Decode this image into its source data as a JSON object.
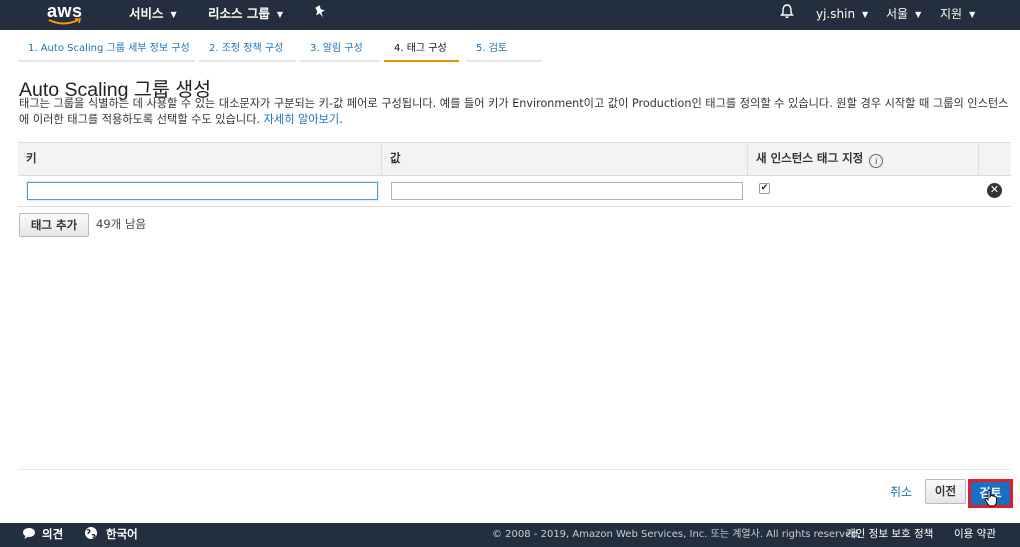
{
  "nav": {
    "logo": "aws",
    "services": "서비스",
    "resource_groups": "리소스 그룹",
    "user": "yj.shin",
    "region": "서울",
    "support": "지원"
  },
  "steps": [
    {
      "label": "1. Auto Scaling 그룹 세부 정보 구성",
      "active": false
    },
    {
      "label": "2. 조정 정책 구성",
      "active": false
    },
    {
      "label": "3. 알림 구성",
      "active": false
    },
    {
      "label": "4. 태그 구성",
      "active": true
    },
    {
      "label": "5. 검토",
      "active": false
    }
  ],
  "page": {
    "title": "Auto Scaling 그룹 생성",
    "description": "태그는 그룹을 식별하는 데 사용할 수 있는 대소문자가 구분되는 키-값 페어로 구성됩니다. 예를 들어 키가 Environment이고 값이 Production인 태그를 정의할 수 있습니다. 원할 경우 시작할 때 그룹의 인스턴스에 이러한 태그를 적용하도록 선택할 수도 있습니다.",
    "learn_more": "자세히 알아보기",
    "learn_more_suffix": "."
  },
  "tags_table": {
    "columns": [
      "키",
      "값",
      "새 인스턴스 태그 지정"
    ],
    "rows": [
      {
        "key": "",
        "value": "",
        "tag_new_instances": true
      }
    ]
  },
  "add_tag_button": "태그 추가",
  "remaining_text": "49개 남음",
  "actions": {
    "cancel": "취소",
    "previous": "이전",
    "review": "검토"
  },
  "footer": {
    "feedback": "의견",
    "language": "한국어",
    "copyright": "© 2008 - 2019, Amazon Web Services, Inc. 또는 계열사. All rights reserved.",
    "privacy": "개인 정보 보호 정책",
    "terms": "이용 약관"
  },
  "colors": {
    "nav_bg": "#232f3e",
    "accent": "#eb8c00",
    "link": "#1a73b8",
    "primary_button": "#1a6fc4",
    "highlight": "#e01e2a"
  }
}
